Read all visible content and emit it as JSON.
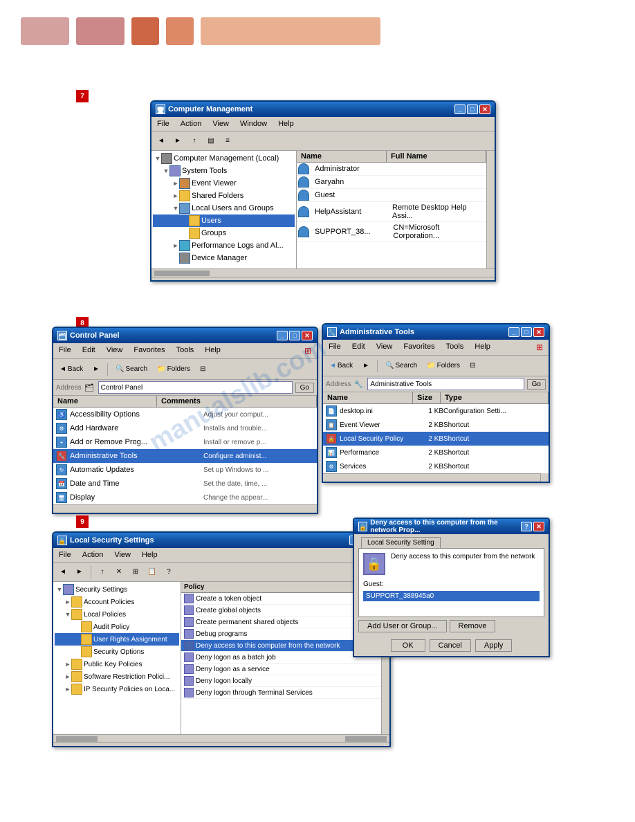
{
  "topbar": {
    "colors": [
      "#d4a0a0",
      "#cc8888",
      "#cc6644",
      "#dd8866",
      "#e8b090",
      "#f0c8a8"
    ]
  },
  "section7": {
    "badge": "7",
    "window": {
      "title": "Computer Management",
      "menus": [
        "File",
        "Action",
        "View",
        "Window",
        "Help"
      ],
      "tree": {
        "items": [
          {
            "label": "Computer Management (Local)",
            "indent": 0,
            "expanded": true
          },
          {
            "label": "System Tools",
            "indent": 1,
            "expanded": true
          },
          {
            "label": "Event Viewer",
            "indent": 2,
            "expanded": false
          },
          {
            "label": "Shared Folders",
            "indent": 2,
            "expanded": false
          },
          {
            "label": "Local Users and Groups",
            "indent": 2,
            "expanded": true
          },
          {
            "label": "Users",
            "indent": 3,
            "expanded": false,
            "selected": true
          },
          {
            "label": "Groups",
            "indent": 3,
            "expanded": false
          },
          {
            "label": "Performance Logs and Al...",
            "indent": 2,
            "expanded": false
          },
          {
            "label": "Device Manager",
            "indent": 2,
            "expanded": false
          }
        ]
      },
      "list": {
        "columns": [
          "Name",
          "Full Name"
        ],
        "rows": [
          {
            "name": "Administrator",
            "fullname": ""
          },
          {
            "name": "Garyahn",
            "fullname": ""
          },
          {
            "name": "Guest",
            "fullname": ""
          },
          {
            "name": "HelpAssistant",
            "fullname": "Remote Desktop Help Assi..."
          },
          {
            "name": "SUPPORT_38...",
            "fullname": "CN=Microsoft Corporation..."
          }
        ]
      }
    }
  },
  "section8": {
    "badge": "8",
    "control_panel": {
      "title": "Control Panel",
      "menus": [
        "File",
        "Edit",
        "View",
        "Favorites",
        "Tools",
        "Help"
      ],
      "address": "Control Panel",
      "list": {
        "columns": [
          "Name",
          "Comments"
        ],
        "rows": [
          {
            "name": "Accessibility Options",
            "comment": "Adjust your comput...",
            "selected": false
          },
          {
            "name": "Add Hardware",
            "comment": "Installs and trouble...",
            "selected": false
          },
          {
            "name": "Add or Remove Prog...",
            "comment": "Install or remove p...",
            "selected": false
          },
          {
            "name": "Administrative Tools",
            "comment": "Configure administ...",
            "selected": true
          },
          {
            "name": "Automatic Updates",
            "comment": "Set up Windows to ...",
            "selected": false
          },
          {
            "name": "Date and Time",
            "comment": "Set the date, time, ...",
            "selected": false
          },
          {
            "name": "Display",
            "comment": "Change the appear...",
            "selected": false
          }
        ]
      }
    },
    "admin_tools": {
      "title": "Administrative Tools",
      "menus": [
        "File",
        "Edit",
        "View",
        "Favorites",
        "Tools",
        "Help"
      ],
      "address": "Administrative Tools",
      "list": {
        "columns": [
          "Name",
          "Size",
          "Type"
        ],
        "rows": [
          {
            "name": "desktop.ini",
            "size": "1 KB",
            "type": "Configuration Setti..."
          },
          {
            "name": "Event Viewer",
            "size": "2 KB",
            "type": "Shortcut",
            "selected": false
          },
          {
            "name": "Local Security Policy",
            "size": "2 KB",
            "type": "Shortcut",
            "selected": true
          },
          {
            "name": "Performance",
            "size": "2 KB",
            "type": "Shortcut",
            "selected": false
          },
          {
            "name": "Services",
            "size": "2 KB",
            "type": "Shortcut",
            "selected": false
          }
        ]
      }
    }
  },
  "section9": {
    "badge": "9",
    "lss_window": {
      "title": "Local Security Settings",
      "menus": [
        "File",
        "Action",
        "View",
        "Help"
      ],
      "tree": {
        "items": [
          {
            "label": "Security Settings",
            "indent": 0,
            "expanded": true
          },
          {
            "label": "Account Policies",
            "indent": 1,
            "expanded": false
          },
          {
            "label": "Local Policies",
            "indent": 1,
            "expanded": true
          },
          {
            "label": "Audit Policy",
            "indent": 2,
            "expanded": false
          },
          {
            "label": "User Rights Assignment",
            "indent": 2,
            "expanded": false,
            "selected": true
          },
          {
            "label": "Security Options",
            "indent": 2,
            "expanded": false
          },
          {
            "label": "Public Key Policies",
            "indent": 1,
            "expanded": false
          },
          {
            "label": "Software Restriction Polici...",
            "indent": 1,
            "expanded": false
          },
          {
            "label": "IP Security Policies on Loca...",
            "indent": 1,
            "expanded": false
          }
        ]
      },
      "policy_list": {
        "items": [
          {
            "label": "Create a token object",
            "selected": false
          },
          {
            "label": "Create global objects",
            "selected": false
          },
          {
            "label": "Create permanent shared objects",
            "selected": false
          },
          {
            "label": "Debug programs",
            "selected": false
          },
          {
            "label": "Deny access to this computer from the network",
            "selected": true
          },
          {
            "label": "Deny logon as a batch job",
            "selected": false
          },
          {
            "label": "Deny logon as a service",
            "selected": false
          },
          {
            "label": "Deny logon locally",
            "selected": false
          },
          {
            "label": "Deny logon through Terminal Services",
            "selected": false
          }
        ]
      }
    },
    "deny_dialog": {
      "title": "Deny access to this computer from the network Prop...",
      "tab_label": "Local Security Setting",
      "description": "Deny access to this computer from the network",
      "icon_label": "Guest:",
      "user": "SUPPORT_388945a0",
      "buttons": {
        "add": "Add User or Group...",
        "remove": "Remove",
        "ok": "OK",
        "cancel": "Cancel",
        "apply": "Apply"
      }
    }
  }
}
